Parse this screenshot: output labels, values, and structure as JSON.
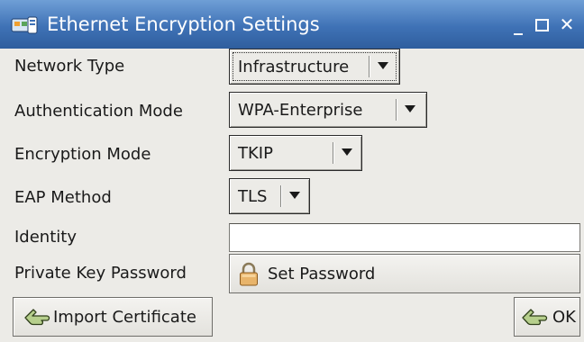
{
  "window": {
    "title": "Ethernet Encryption Settings",
    "controls": {
      "minimize": "_",
      "close": "✕"
    },
    "title_icon": "network-card-icon",
    "accent": "#3f72b6"
  },
  "form": {
    "network_type": {
      "label": "Network Type",
      "value": "Infrastructure"
    },
    "auth_mode": {
      "label": "Authentication Mode",
      "value": "WPA-Enterprise"
    },
    "encryption_mode": {
      "label": "Encryption Mode",
      "value": "TKIP"
    },
    "eap_method": {
      "label": "EAP Method",
      "value": "TLS"
    },
    "identity": {
      "label": "Identity",
      "value": ""
    },
    "private_key_password": {
      "label": "Private Key Password",
      "button_label": "Set Password",
      "icon": "padlock-icon"
    }
  },
  "footer": {
    "import_label": "Import Certificate",
    "ok_label": "OK",
    "button_icon": "hand-pointing-icon"
  }
}
